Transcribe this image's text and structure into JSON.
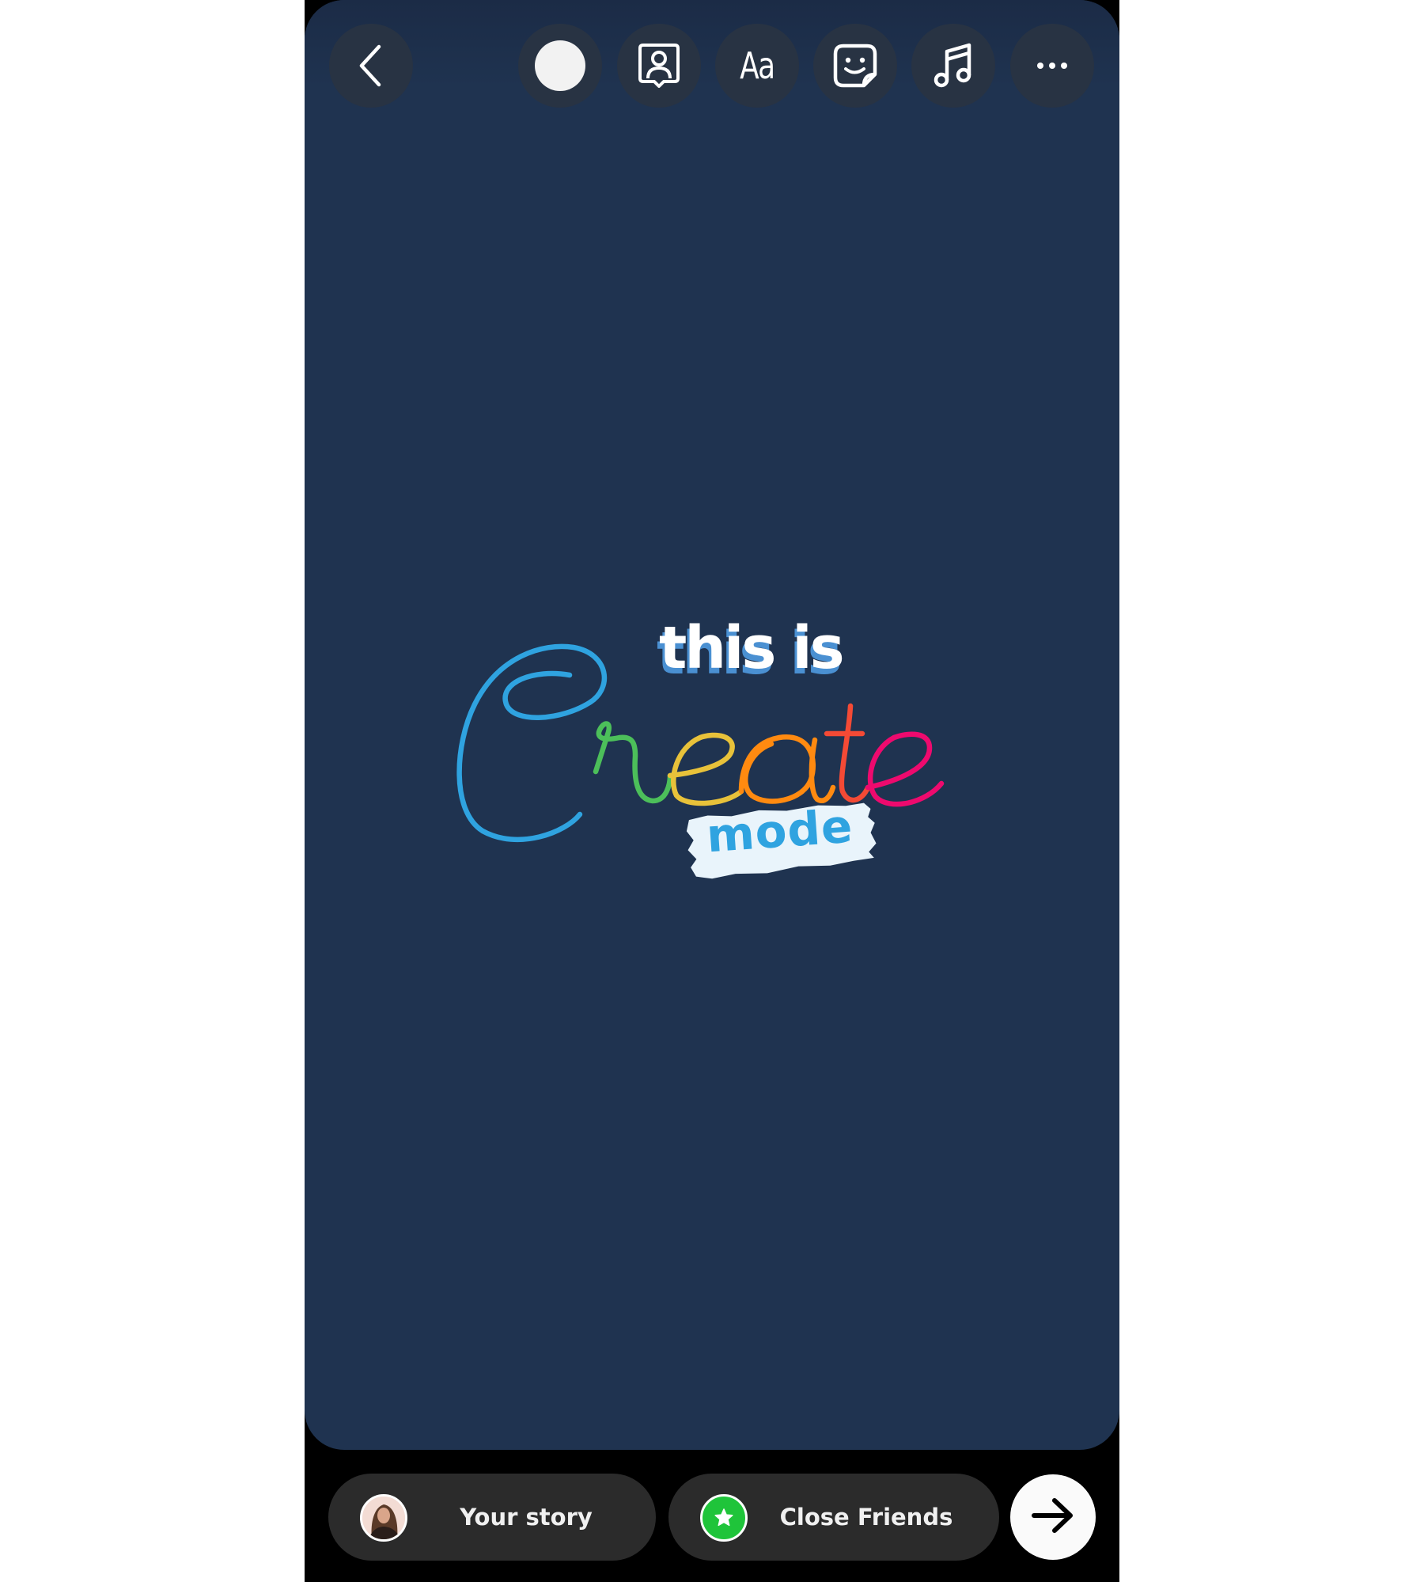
{
  "toolbar": {
    "back": {
      "icon": "chevron-left-icon"
    },
    "color": {
      "icon": "color-circle-icon",
      "value": "#f2f2f2"
    },
    "mention": {
      "icon": "profile-frame-icon"
    },
    "text": {
      "label": "Aa",
      "icon": "text-tool-icon"
    },
    "sticker": {
      "icon": "sticker-icon"
    },
    "music": {
      "icon": "music-note-icon"
    },
    "more": {
      "icon": "more-dots-icon"
    }
  },
  "canvas": {
    "background": "#1f3350",
    "sticker": {
      "line1": "this is",
      "script_word": "Create",
      "line3": "mode",
      "letter_colors": {
        "C": "#2fa3e0",
        "r": "#4cbf5a",
        "e1": "#e8c23a",
        "a": "#ff8a10",
        "t": "#f44a35",
        "e2": "#ee0a6e"
      },
      "shadow_color": "#4a90d2",
      "mode_color": "#2fa3e0"
    }
  },
  "share": {
    "your_story": {
      "label": "Your story",
      "icon": "avatar"
    },
    "close_friends": {
      "label": "Close Friends",
      "icon": "green-star-icon",
      "badge_color": "#1fc43a"
    },
    "next": {
      "icon": "arrow-right-icon"
    }
  }
}
